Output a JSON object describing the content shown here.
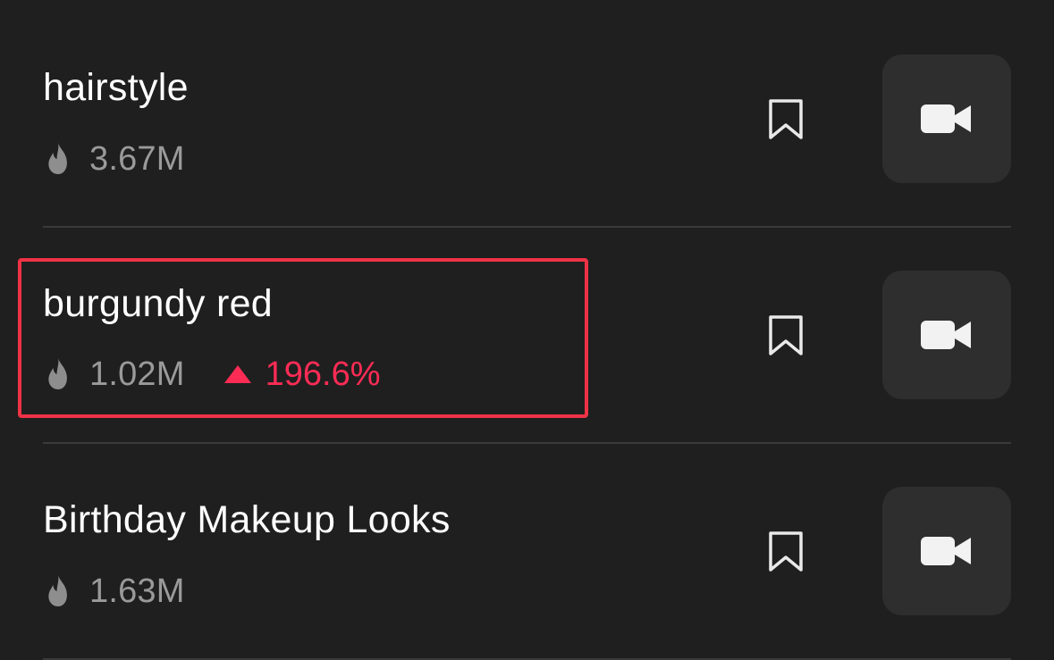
{
  "colors": {
    "background": "#1f1f1f",
    "card": "#2e2e2e",
    "divider": "#3a3a3a",
    "meta_text": "#9a9a9a",
    "trend_up": "#fe2c55",
    "highlight_border": "#ef3346"
  },
  "icons": {
    "views": "flame-icon",
    "save": "bookmark-icon",
    "record": "video-camera-icon",
    "trend": "triangle-up-icon"
  },
  "trends": [
    {
      "title": "hairstyle",
      "views": "3.67M",
      "change": ""
    },
    {
      "title": "burgundy red",
      "views": "1.02M",
      "change": "196.6%",
      "highlighted": true
    },
    {
      "title": "Birthday Makeup Looks",
      "views": "1.63M",
      "change": ""
    }
  ]
}
